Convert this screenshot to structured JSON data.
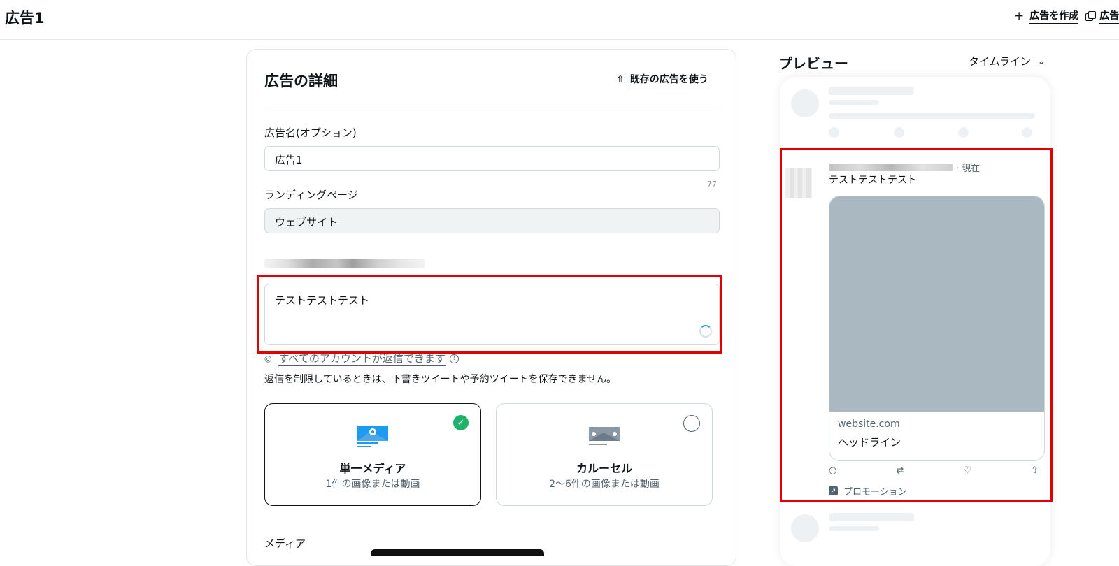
{
  "header": {
    "title": "広告1",
    "create_ad_label": "広告を作成",
    "duplicate_label_partial": "広告"
  },
  "details": {
    "title": "広告の詳細",
    "use_existing_label": "既存の広告を使う",
    "ad_name_label": "広告名(オプション)",
    "ad_name_value": "広告1",
    "ad_name_counter": "77",
    "landing_label": "ランディングページ",
    "landing_value": "ウェブサイト",
    "tweet_text": "テストテストテスト",
    "reply_setting": "すべてのアカウントが返信できます",
    "reply_note": "返信を制限しているときは、下書きツイートや予約ツイートを保存できません。",
    "media_options": [
      {
        "title": "単一メディア",
        "subtitle": "1件の画像または動画",
        "selected": true
      },
      {
        "title": "カルーセル",
        "subtitle": "2〜6件の画像または動画",
        "selected": false
      }
    ],
    "media_label": "メディア"
  },
  "preview": {
    "title": "プレビュー",
    "placement": "タイムライン",
    "tweet_time": "· 現在",
    "tweet_text": "テストテストテスト",
    "card_domain": "website.com",
    "card_headline": "ヘッドライン",
    "promoted_label": "プロモーション"
  },
  "colors": {
    "highlight": "#e00000",
    "check": "#1fb36a",
    "media_placeholder": "#aab8c2"
  }
}
